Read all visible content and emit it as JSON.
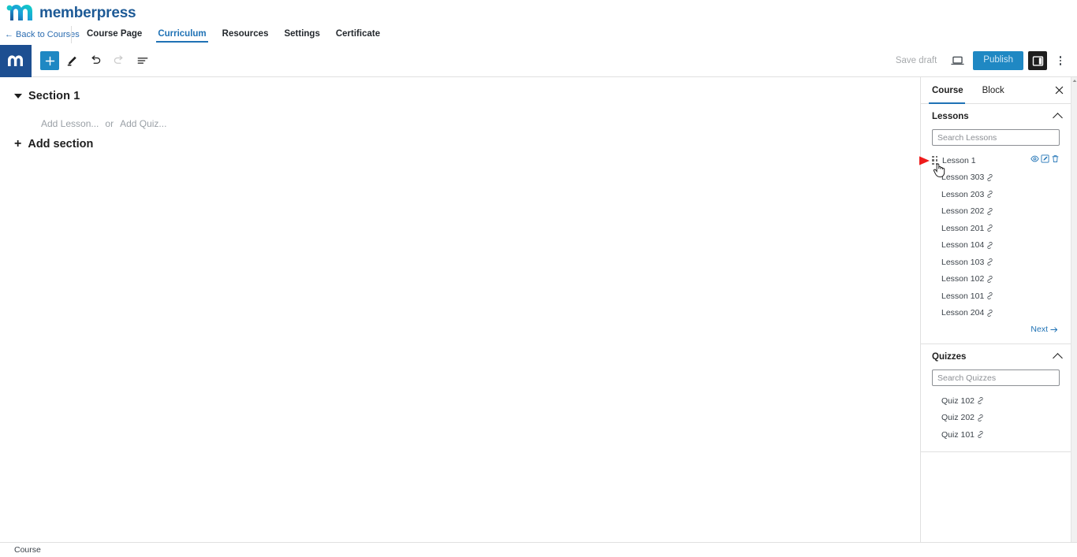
{
  "brand": {
    "name": "memberpress",
    "logo_icon": "memberpress-m-logo",
    "color": "#1d5a96"
  },
  "course_nav": {
    "back_label": "← Back to Courses",
    "tabs": [
      {
        "label": "Course Page",
        "active": false
      },
      {
        "label": "Curriculum",
        "active": true
      },
      {
        "label": "Resources",
        "active": false
      },
      {
        "label": "Settings",
        "active": false
      },
      {
        "label": "Certificate",
        "active": false
      }
    ],
    "active_color": "#1f72b5"
  },
  "editor_toolbar": {
    "logo_icon": "memberpress-m-icon",
    "add_block_icon": "plus-icon",
    "edit_tool_icon": "pencil-icon",
    "undo_icon": "undo-arrow-icon",
    "redo_icon": "redo-arrow-icon",
    "outline_icon": "document-outline-icon",
    "save_draft_label": "Save draft",
    "preview_icon": "laptop-preview-icon",
    "publish_label": "Publish",
    "sidebar_toggle_icon": "settings-sidebar-icon",
    "more_menu_icon": "kebab-menu-icon",
    "publish_color": "#1f88c3"
  },
  "canvas": {
    "section_title": "Section 1",
    "collapse_icon": "caret-down-icon",
    "add_lesson_label": "Add Lesson...",
    "or_label": "or",
    "add_quiz_label": "Add Quiz...",
    "add_section_icon": "plus-icon",
    "add_section_label": "Add section"
  },
  "sidebar": {
    "tabs": [
      {
        "label": "Course",
        "active": true
      },
      {
        "label": "Block",
        "active": false
      }
    ],
    "close_icon": "close-icon",
    "panels": [
      {
        "title": "Lessons",
        "collapse_icon": "chevron-up-icon",
        "search_placeholder": "Search Lessons",
        "search_value": "",
        "items": [
          {
            "label": "Lesson 1",
            "hovered": true,
            "icon": "drag-handle-icon",
            "actions": [
              {
                "name": "view-lesson",
                "icon": "eye-icon"
              },
              {
                "name": "edit-lesson",
                "icon": "pencil-square-icon"
              },
              {
                "name": "delete-lesson",
                "icon": "trash-icon"
              }
            ]
          },
          {
            "label": "Lesson 303",
            "hovered": false,
            "icon": "link-icon"
          },
          {
            "label": "Lesson 203",
            "hovered": false,
            "icon": "link-icon"
          },
          {
            "label": "Lesson 202",
            "hovered": false,
            "icon": "link-icon"
          },
          {
            "label": "Lesson 201",
            "hovered": false,
            "icon": "link-icon"
          },
          {
            "label": "Lesson 104",
            "hovered": false,
            "icon": "link-icon"
          },
          {
            "label": "Lesson 103",
            "hovered": false,
            "icon": "link-icon"
          },
          {
            "label": "Lesson 102",
            "hovered": false,
            "icon": "link-icon"
          },
          {
            "label": "Lesson 101",
            "hovered": false,
            "icon": "link-icon"
          },
          {
            "label": "Lesson 204",
            "hovered": false,
            "icon": "link-icon"
          }
        ],
        "next_label": "Next",
        "next_icon": "arrow-right-icon"
      },
      {
        "title": "Quizzes",
        "collapse_icon": "chevron-up-icon",
        "search_placeholder": "Search Quizzes",
        "search_value": "",
        "items": [
          {
            "label": "Quiz 102",
            "hovered": false,
            "icon": "link-icon"
          },
          {
            "label": "Quiz 202",
            "hovered": false,
            "icon": "link-icon"
          },
          {
            "label": "Quiz 101",
            "hovered": false,
            "icon": "link-icon"
          }
        ]
      }
    ]
  },
  "annotation": {
    "arrow_icon": "red-arrow-pointing-right",
    "color": "#ee1c1c"
  },
  "cursor": {
    "icon": "hand-pointer-cursor"
  },
  "status_bar": {
    "label": "Course"
  }
}
